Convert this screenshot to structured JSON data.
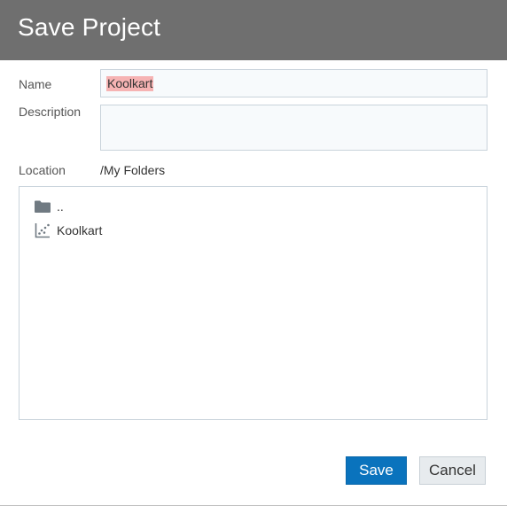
{
  "dialog": {
    "title": "Save Project"
  },
  "form": {
    "name_label": "Name",
    "name_value": "Koolkart",
    "description_label": "Description",
    "description_value": "",
    "location_label": "Location",
    "location_value": "/My Folders"
  },
  "browser": {
    "items": [
      {
        "label": "..",
        "icon": "folder-icon"
      },
      {
        "label": "Koolkart",
        "icon": "scatter-chart-icon"
      }
    ]
  },
  "buttons": {
    "save_label": "Save",
    "cancel_label": "Cancel"
  },
  "colors": {
    "titlebar_bg": "#6f6f6f",
    "primary_button": "#0a73bd",
    "selection_highlight": "#f6b3b3"
  }
}
